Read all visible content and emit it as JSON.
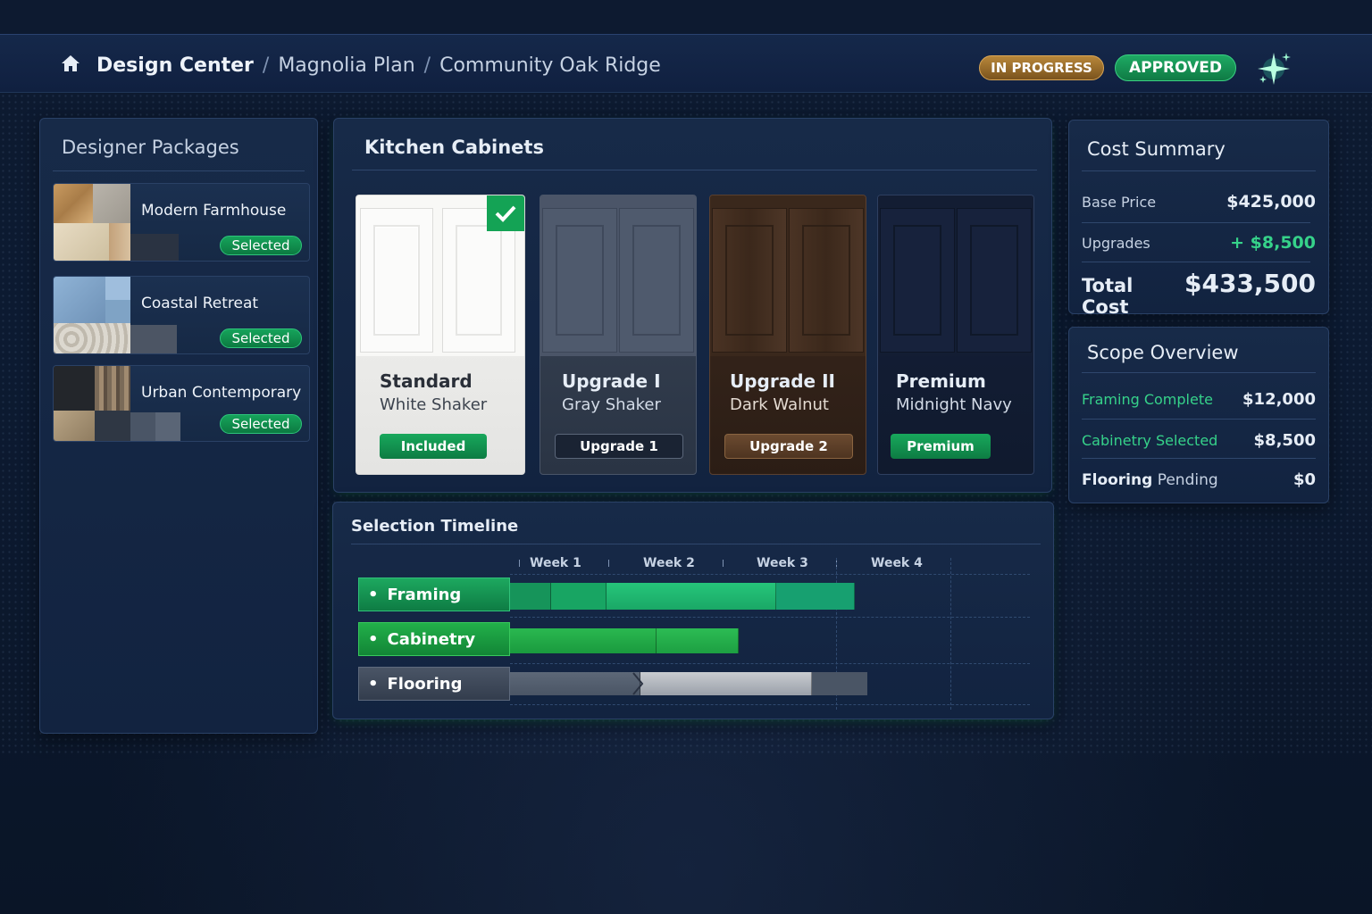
{
  "header": {
    "crumbs": [
      "Design Center",
      "Magnolia Plan",
      "Community Oak Ridge"
    ],
    "separator": "/",
    "badges": {
      "progress": "IN PROGRESS",
      "approved": "APPROVED"
    }
  },
  "packages": {
    "title": "Designer Packages",
    "items": [
      {
        "name": "Modern Farmhouse",
        "status": "Selected"
      },
      {
        "name": "Coastal Retreat",
        "status": "Selected"
      },
      {
        "name": "Urban Contemporary",
        "status": "Selected"
      }
    ]
  },
  "cabinets": {
    "title": "Kitchen Cabinets",
    "options": [
      {
        "title": "Standard",
        "subtitle": "White Shaker",
        "button": "Included",
        "selected": true
      },
      {
        "title": "Upgrade I",
        "subtitle": "Gray Shaker",
        "button": "Upgrade 1"
      },
      {
        "title": "Upgrade II",
        "subtitle": "Dark Walnut",
        "button": "Upgrade 2"
      },
      {
        "title": "Premium",
        "subtitle": "Midnight Navy",
        "button": "Premium"
      }
    ]
  },
  "timeline": {
    "title": "Selection Timeline",
    "weeks": [
      "Week 1",
      "Week 2",
      "Week 3",
      "Week 4"
    ],
    "rows": [
      {
        "label": "Framing",
        "status": "complete"
      },
      {
        "label": "Cabinetry",
        "status": "selected"
      },
      {
        "label": "Flooring",
        "status": "pending"
      }
    ]
  },
  "cost_summary": {
    "title": "Cost Summary",
    "rows": [
      {
        "label": "Base Price",
        "value": "$425,000"
      },
      {
        "label": "Upgrades",
        "value": "+ $8,500"
      }
    ],
    "total": {
      "label": "Total Cost",
      "value": "$433,500"
    }
  },
  "scope_overview": {
    "title": "Scope Overview",
    "rows": [
      {
        "label": "Framing Complete",
        "value": "$12,000"
      },
      {
        "label": "Cabinetry Selected",
        "value": "$8,500"
      },
      {
        "label_strong": "Flooring",
        "label_rest": "Pending",
        "value": "$0"
      }
    ]
  },
  "colors": {
    "accent_green": "#16a35b",
    "accent_gold": "#b8873a",
    "background": "#0c1a31"
  }
}
